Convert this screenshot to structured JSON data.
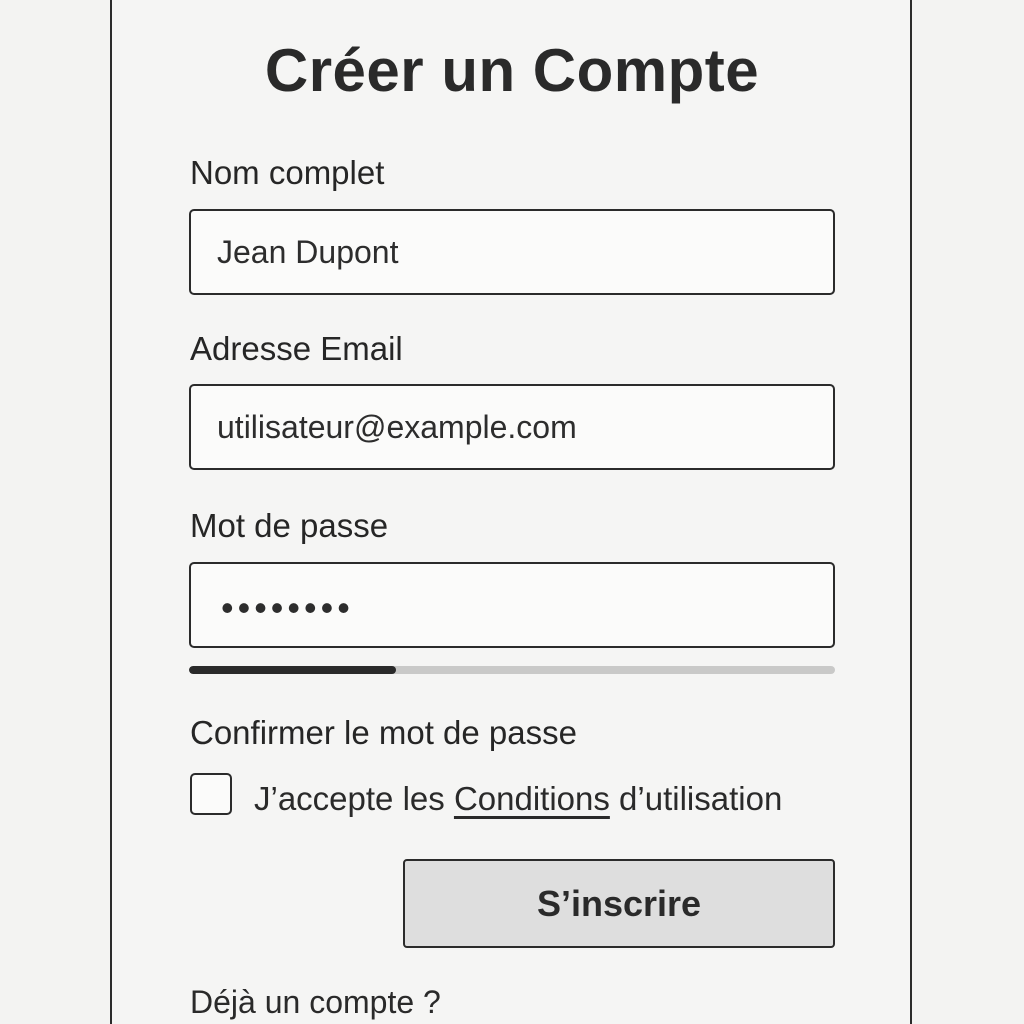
{
  "title": "Créer un Compte",
  "fields": {
    "name": {
      "label": "Nom complet",
      "value": "Jean Dupont"
    },
    "email": {
      "label": "Adresse Email",
      "value": "utilisateur@example.com"
    },
    "password": {
      "label": "Mot de passe",
      "masked_value": "••••••••"
    },
    "confirm_password": {
      "label": "Confirmer le mot de passe"
    }
  },
  "password_strength": {
    "fraction": 0.32
  },
  "terms": {
    "prefix": "J’accepte les ",
    "link": "Conditions",
    "suffix": " d’utilisation",
    "checked": false
  },
  "submit_label": "S’inscrire",
  "login_prompt": "Déjà un compte ?"
}
